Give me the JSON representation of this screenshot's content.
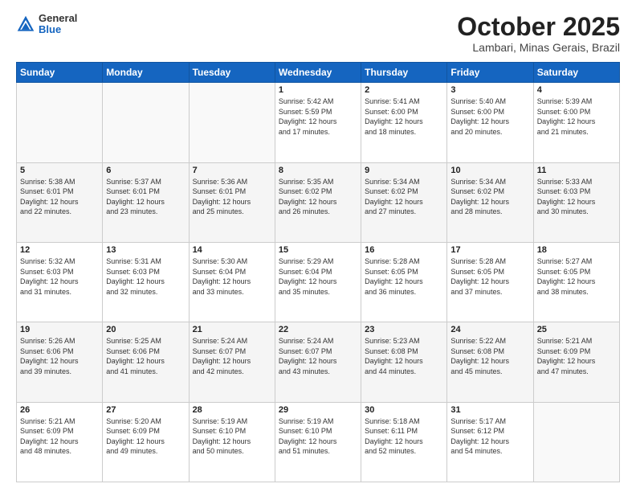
{
  "logo": {
    "general": "General",
    "blue": "Blue"
  },
  "header": {
    "month": "October 2025",
    "location": "Lambari, Minas Gerais, Brazil"
  },
  "weekdays": [
    "Sunday",
    "Monday",
    "Tuesday",
    "Wednesday",
    "Thursday",
    "Friday",
    "Saturday"
  ],
  "weeks": [
    [
      {
        "day": "",
        "info": ""
      },
      {
        "day": "",
        "info": ""
      },
      {
        "day": "",
        "info": ""
      },
      {
        "day": "1",
        "info": "Sunrise: 5:42 AM\nSunset: 5:59 PM\nDaylight: 12 hours\nand 17 minutes."
      },
      {
        "day": "2",
        "info": "Sunrise: 5:41 AM\nSunset: 6:00 PM\nDaylight: 12 hours\nand 18 minutes."
      },
      {
        "day": "3",
        "info": "Sunrise: 5:40 AM\nSunset: 6:00 PM\nDaylight: 12 hours\nand 20 minutes."
      },
      {
        "day": "4",
        "info": "Sunrise: 5:39 AM\nSunset: 6:00 PM\nDaylight: 12 hours\nand 21 minutes."
      }
    ],
    [
      {
        "day": "5",
        "info": "Sunrise: 5:38 AM\nSunset: 6:01 PM\nDaylight: 12 hours\nand 22 minutes."
      },
      {
        "day": "6",
        "info": "Sunrise: 5:37 AM\nSunset: 6:01 PM\nDaylight: 12 hours\nand 23 minutes."
      },
      {
        "day": "7",
        "info": "Sunrise: 5:36 AM\nSunset: 6:01 PM\nDaylight: 12 hours\nand 25 minutes."
      },
      {
        "day": "8",
        "info": "Sunrise: 5:35 AM\nSunset: 6:02 PM\nDaylight: 12 hours\nand 26 minutes."
      },
      {
        "day": "9",
        "info": "Sunrise: 5:34 AM\nSunset: 6:02 PM\nDaylight: 12 hours\nand 27 minutes."
      },
      {
        "day": "10",
        "info": "Sunrise: 5:34 AM\nSunset: 6:02 PM\nDaylight: 12 hours\nand 28 minutes."
      },
      {
        "day": "11",
        "info": "Sunrise: 5:33 AM\nSunset: 6:03 PM\nDaylight: 12 hours\nand 30 minutes."
      }
    ],
    [
      {
        "day": "12",
        "info": "Sunrise: 5:32 AM\nSunset: 6:03 PM\nDaylight: 12 hours\nand 31 minutes."
      },
      {
        "day": "13",
        "info": "Sunrise: 5:31 AM\nSunset: 6:03 PM\nDaylight: 12 hours\nand 32 minutes."
      },
      {
        "day": "14",
        "info": "Sunrise: 5:30 AM\nSunset: 6:04 PM\nDaylight: 12 hours\nand 33 minutes."
      },
      {
        "day": "15",
        "info": "Sunrise: 5:29 AM\nSunset: 6:04 PM\nDaylight: 12 hours\nand 35 minutes."
      },
      {
        "day": "16",
        "info": "Sunrise: 5:28 AM\nSunset: 6:05 PM\nDaylight: 12 hours\nand 36 minutes."
      },
      {
        "day": "17",
        "info": "Sunrise: 5:28 AM\nSunset: 6:05 PM\nDaylight: 12 hours\nand 37 minutes."
      },
      {
        "day": "18",
        "info": "Sunrise: 5:27 AM\nSunset: 6:05 PM\nDaylight: 12 hours\nand 38 minutes."
      }
    ],
    [
      {
        "day": "19",
        "info": "Sunrise: 5:26 AM\nSunset: 6:06 PM\nDaylight: 12 hours\nand 39 minutes."
      },
      {
        "day": "20",
        "info": "Sunrise: 5:25 AM\nSunset: 6:06 PM\nDaylight: 12 hours\nand 41 minutes."
      },
      {
        "day": "21",
        "info": "Sunrise: 5:24 AM\nSunset: 6:07 PM\nDaylight: 12 hours\nand 42 minutes."
      },
      {
        "day": "22",
        "info": "Sunrise: 5:24 AM\nSunset: 6:07 PM\nDaylight: 12 hours\nand 43 minutes."
      },
      {
        "day": "23",
        "info": "Sunrise: 5:23 AM\nSunset: 6:08 PM\nDaylight: 12 hours\nand 44 minutes."
      },
      {
        "day": "24",
        "info": "Sunrise: 5:22 AM\nSunset: 6:08 PM\nDaylight: 12 hours\nand 45 minutes."
      },
      {
        "day": "25",
        "info": "Sunrise: 5:21 AM\nSunset: 6:09 PM\nDaylight: 12 hours\nand 47 minutes."
      }
    ],
    [
      {
        "day": "26",
        "info": "Sunrise: 5:21 AM\nSunset: 6:09 PM\nDaylight: 12 hours\nand 48 minutes."
      },
      {
        "day": "27",
        "info": "Sunrise: 5:20 AM\nSunset: 6:09 PM\nDaylight: 12 hours\nand 49 minutes."
      },
      {
        "day": "28",
        "info": "Sunrise: 5:19 AM\nSunset: 6:10 PM\nDaylight: 12 hours\nand 50 minutes."
      },
      {
        "day": "29",
        "info": "Sunrise: 5:19 AM\nSunset: 6:10 PM\nDaylight: 12 hours\nand 51 minutes."
      },
      {
        "day": "30",
        "info": "Sunrise: 5:18 AM\nSunset: 6:11 PM\nDaylight: 12 hours\nand 52 minutes."
      },
      {
        "day": "31",
        "info": "Sunrise: 5:17 AM\nSunset: 6:12 PM\nDaylight: 12 hours\nand 54 minutes."
      },
      {
        "day": "",
        "info": ""
      }
    ]
  ]
}
